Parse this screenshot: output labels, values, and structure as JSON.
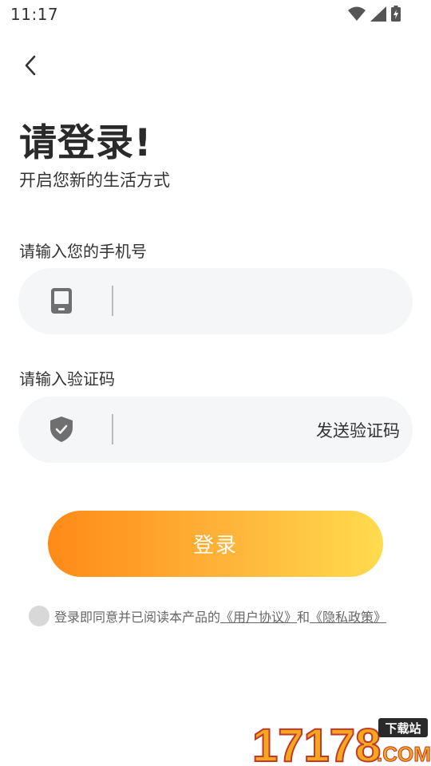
{
  "status_bar": {
    "time": "11:17",
    "icons": [
      "wifi-icon",
      "cellular-signal-icon",
      "battery-charging-icon"
    ]
  },
  "nav": {
    "back_icon": "chevron-left-icon"
  },
  "header": {
    "title": "请登录!",
    "subtitle": "开启您新的生活方式"
  },
  "phone": {
    "label": "请输入您的手机号",
    "icon": "phone-icon",
    "value": "",
    "placeholder": ""
  },
  "code": {
    "label": "请输入验证码",
    "icon": "shield-check-icon",
    "value": "",
    "placeholder": "",
    "send_label": "发送验证码"
  },
  "login": {
    "label": "登录"
  },
  "agreement": {
    "checked": false,
    "text": "登录即同意并已阅读本产品的",
    "terms_link": "《用户协议》",
    "and": "和",
    "privacy_link": "《隐私政策》"
  },
  "watermark": {
    "number": "17178",
    "badge": "下载站",
    "domain": ".COM"
  },
  "colors": {
    "accent_start": "#ff8a17",
    "accent_end": "#ffdc4e",
    "field_bg": "#f5f6f8"
  }
}
